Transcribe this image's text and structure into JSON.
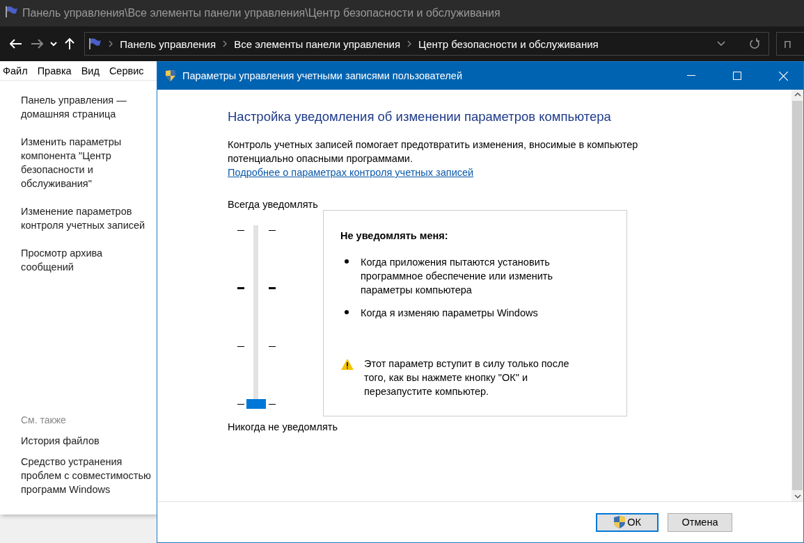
{
  "window": {
    "title": "Панель управления\\Все элементы панели управления\\Центр безопасности и обслуживания"
  },
  "address_bar": {
    "breadcrumbs": [
      "Панель управления",
      "Все элементы панели управления",
      "Центр безопасности и обслуживания"
    ]
  },
  "search": {
    "placeholder": "П"
  },
  "menu": [
    "Файл",
    "Правка",
    "Вид",
    "Сервис"
  ],
  "sidebar": {
    "links": [
      "Панель управления — домашняя страница",
      "Изменить параметры компонента \"Центр безопасности и обслуживания\"",
      "Изменение параметров контроля учетных записей",
      "Просмотр архива сообщений"
    ],
    "see_also_title": "См. также",
    "see_also": [
      "История файлов",
      "Средство устранения проблем с совместимостью программ Windows"
    ]
  },
  "dialog": {
    "title": "Параметры управления учетными записями пользователей",
    "heading": "Настройка уведомления об изменении параметров компьютера",
    "description": "Контроль учетных записей помогает предотвратить изменения, вносимые в компьютер потенциально опасными программами.",
    "link": "Подробнее о параметрах контроля учетных записей",
    "slider": {
      "top_label": "Всегда уведомлять",
      "bottom_label": "Никогда не уведомлять",
      "level": 0,
      "ticks": [
        {
          "emphasized": false
        },
        {
          "emphasized": true
        },
        {
          "emphasized": false
        },
        {
          "emphasized": false
        }
      ]
    },
    "info": {
      "title": "Не уведомлять меня:",
      "bullets": [
        "Когда приложения пытаются установить программное обеспечение или изменить параметры компьютера",
        "Когда я изменяю параметры Windows"
      ],
      "warning": "Этот параметр вступит в силу только после того, как вы нажмете кнопку \"ОК\" и перезапустите компьютер."
    },
    "buttons": [
      {
        "label": "ОК",
        "kind": "shield",
        "default": true
      },
      {
        "label": "Отмена",
        "kind": "plain",
        "default": false
      }
    ]
  }
}
